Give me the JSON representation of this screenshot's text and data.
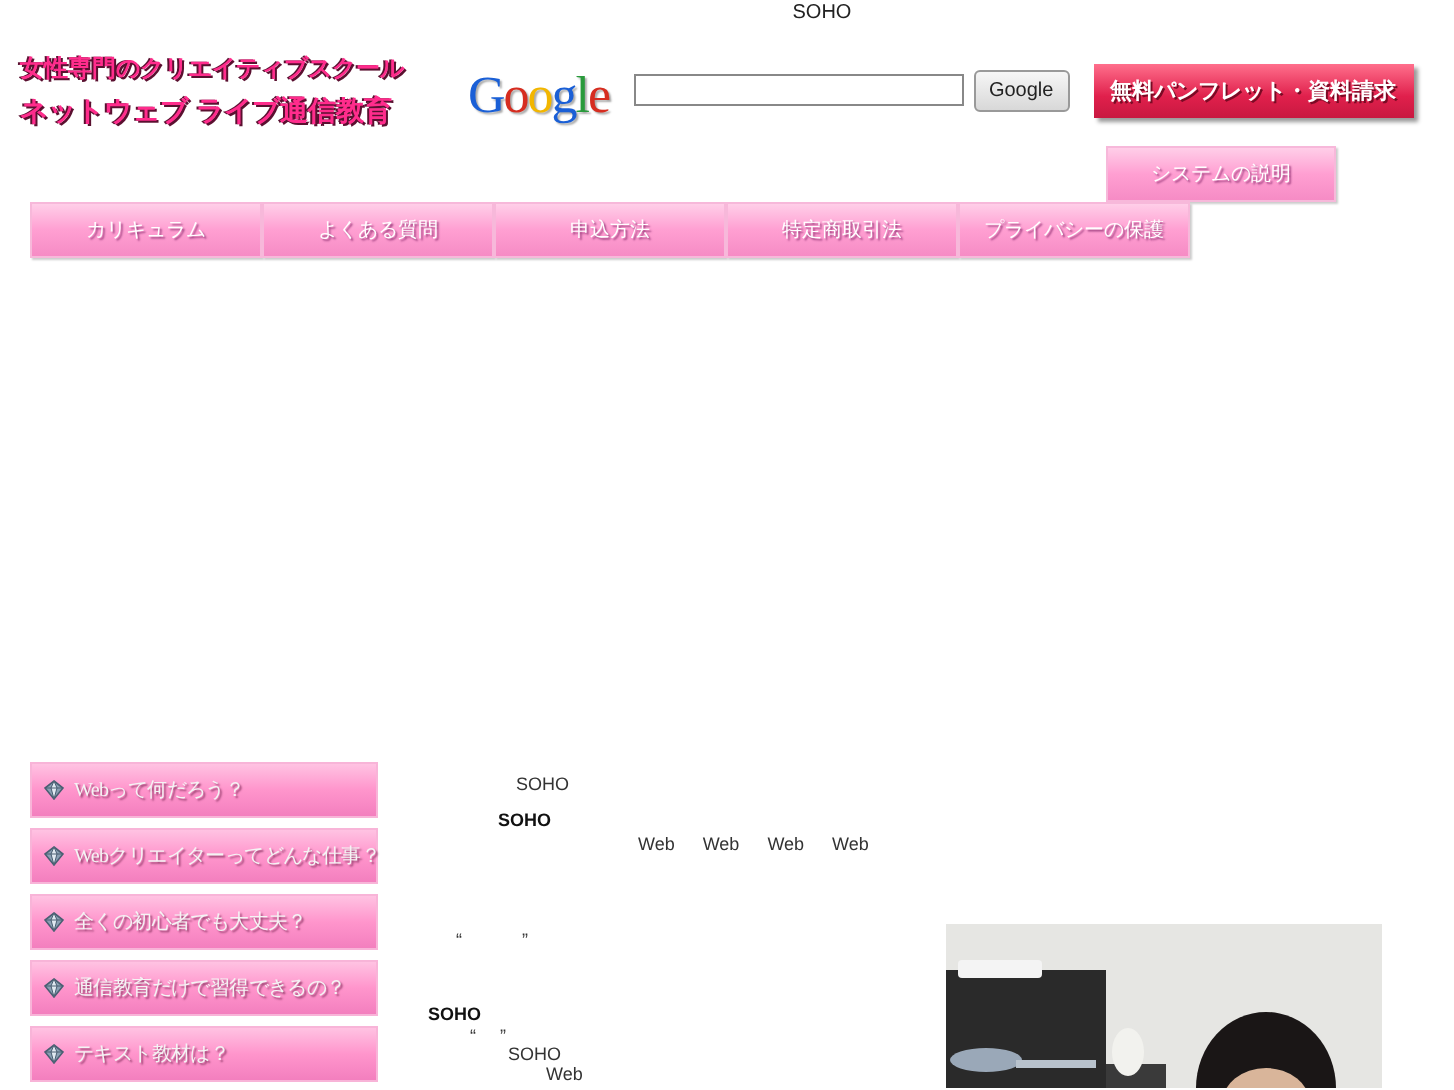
{
  "top_text": "SOHO",
  "logo": {
    "tagline": "女性専門のクリエイティブスクール",
    "name": "ネットウェブ ライブ通信教育"
  },
  "search": {
    "logo": "Google",
    "button": "Google"
  },
  "request_button": "無料パンフレット・資料請求",
  "system_button": "システムの説明",
  "nav": [
    "カリキュラム",
    "よくある質問",
    "申込方法",
    "特定商取引法",
    "プライバシーの保護"
  ],
  "side_menu": [
    "Webって何だろう？",
    "Webクリエイターってどんな仕事？",
    "全くの初心者でも大丈夫？",
    "通信教育だけで習得できるの？",
    "テキスト教材は？"
  ],
  "content": {
    "lines": [
      {
        "bold": false,
        "items": [
          "SOHO"
        ]
      },
      {
        "bold": true,
        "items": [
          "SOHO"
        ]
      },
      {
        "bold": false,
        "items": [
          "Web",
          "Web",
          "Web",
          "Web"
        ]
      },
      {
        "bold": false,
        "items": [
          "“",
          "”"
        ]
      },
      {
        "bold": true,
        "items": [
          "SOHO"
        ]
      },
      {
        "bold": false,
        "items": [
          "“",
          "”"
        ]
      },
      {
        "bold": false,
        "items": [
          "SOHO"
        ]
      },
      {
        "bold": false,
        "items": [
          "Web"
        ]
      }
    ]
  }
}
